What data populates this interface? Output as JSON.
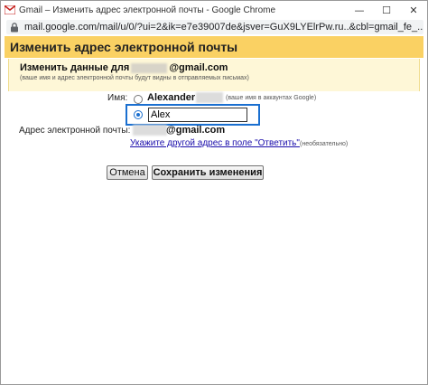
{
  "window": {
    "title": "Gmail – Изменить адрес электронной почты - Google Chrome",
    "controls": {
      "minimize": "—",
      "maximize": "☐",
      "close": "✕"
    }
  },
  "browser": {
    "url": "mail.google.com/mail/u/0/?ui=2&ik=e7e39007de&jsver=GuX9LYElrPw.ru..&cbl=gmail_fe_..."
  },
  "dialog": {
    "header": "Изменить адрес электронной почты",
    "section_title_prefix": "Изменить данные для",
    "section_title_suffix": "@gmail.com",
    "section_subtitle": "(ваше имя и адрес электронной почты будут видны в отправляемых письмах)",
    "name_label": "Имя:",
    "name_options": [
      {
        "label": "Alexander",
        "hint": "(ваше имя в аккаунтах Google)",
        "selected": false
      },
      {
        "value": "Alex",
        "selected": true
      }
    ],
    "email_label": "Адрес электронной почты:",
    "email_suffix": "@gmail.com",
    "reply_to_link": "Укажите другой адрес в поле \"Ответить\"",
    "reply_to_hint": "(необязательно)",
    "cancel_button": "Отмена",
    "save_button": "Сохранить изменения"
  }
}
